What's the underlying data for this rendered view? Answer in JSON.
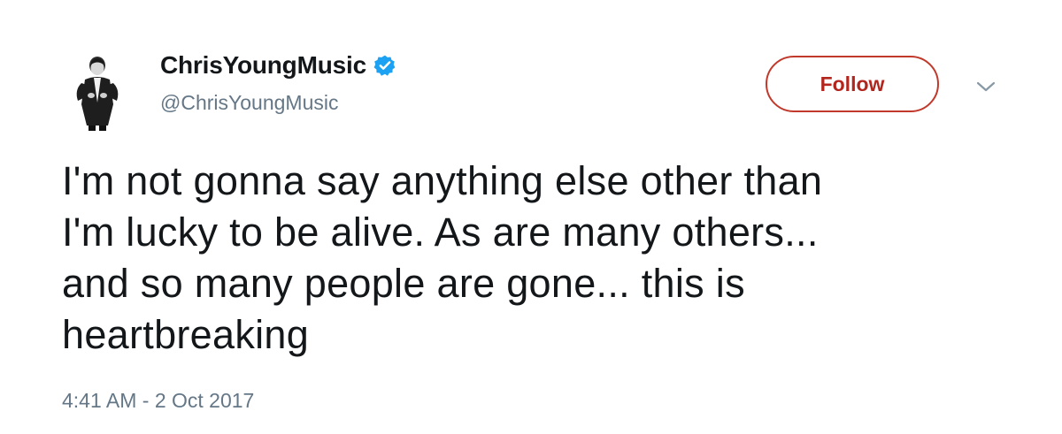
{
  "user": {
    "display_name": "ChrisYoungMusic",
    "handle": "@ChrisYoungMusic",
    "verified": true,
    "verified_color": "#1da1f2"
  },
  "actions": {
    "follow_label": "Follow",
    "follow_color": "#b3261e",
    "menu_icon": "chevron-down-icon"
  },
  "tweet": {
    "lines": [
      "I'm not gonna say anything else other than",
      "I'm lucky to be alive. As are many others...",
      "and so many people are gone... this is",
      "heartbreaking"
    ],
    "timestamp": "4:41 AM - 2 Oct 2017"
  },
  "colors": {
    "text": "#14171a",
    "secondary": "#657786"
  }
}
